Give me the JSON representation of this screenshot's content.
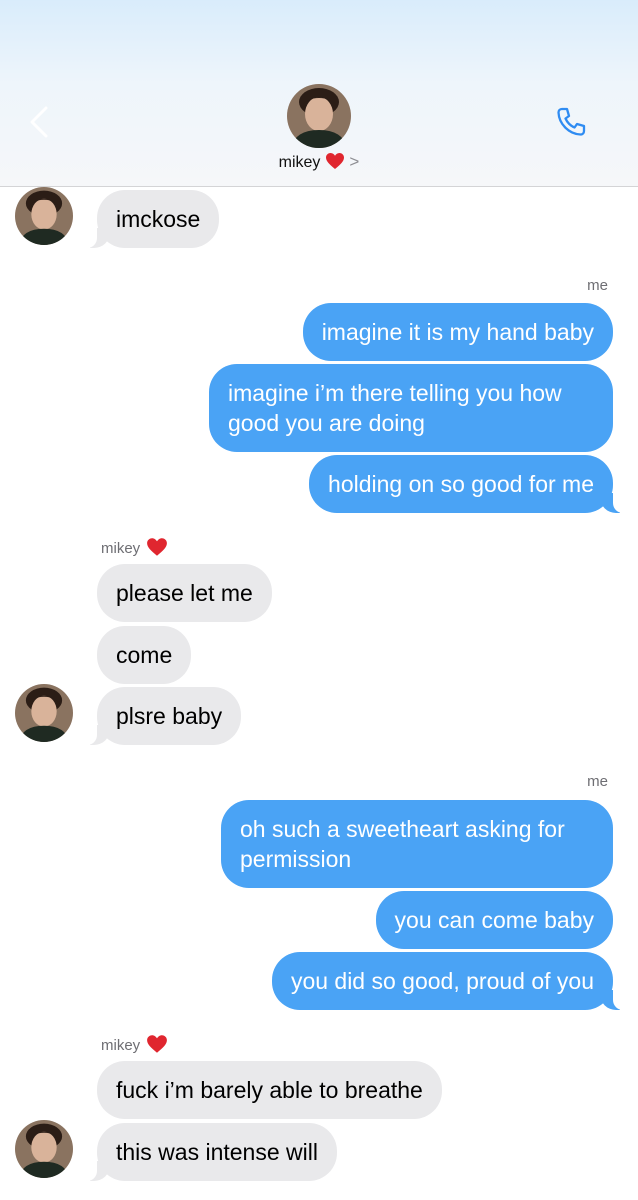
{
  "header": {
    "contact_name": "mikey",
    "name_emoji": "red-heart",
    "chevron": ">",
    "back_icon": "chevron-left-icon",
    "call_icon": "phone-icon"
  },
  "colors": {
    "incoming_bubble": "#e9e9eb",
    "outgoing_bubble": "#4aa3f5",
    "accent": "#2f8cf2"
  },
  "messages": [
    {
      "from": "mikey",
      "text": "imckose"
    },
    {
      "sender_label": "me"
    },
    {
      "from": "me",
      "text": "imagine it is my hand baby"
    },
    {
      "from": "me",
      "text": "imagine i’m there telling you how good you are doing"
    },
    {
      "from": "me",
      "text": "holding on so good for me"
    },
    {
      "sender_label": "mikey"
    },
    {
      "from": "mikey",
      "text": "please let me"
    },
    {
      "from": "mikey",
      "text": "come"
    },
    {
      "from": "mikey",
      "text": "plsre baby"
    },
    {
      "sender_label": "me"
    },
    {
      "from": "me",
      "text": "oh such a sweetheart asking for permission"
    },
    {
      "from": "me",
      "text": "you can come baby"
    },
    {
      "from": "me",
      "text": "you did so good, proud of you"
    },
    {
      "sender_label": "mikey"
    },
    {
      "from": "mikey",
      "text": "fuck i’m barely able to breathe"
    },
    {
      "from": "mikey",
      "text": "this was intense will"
    }
  ]
}
